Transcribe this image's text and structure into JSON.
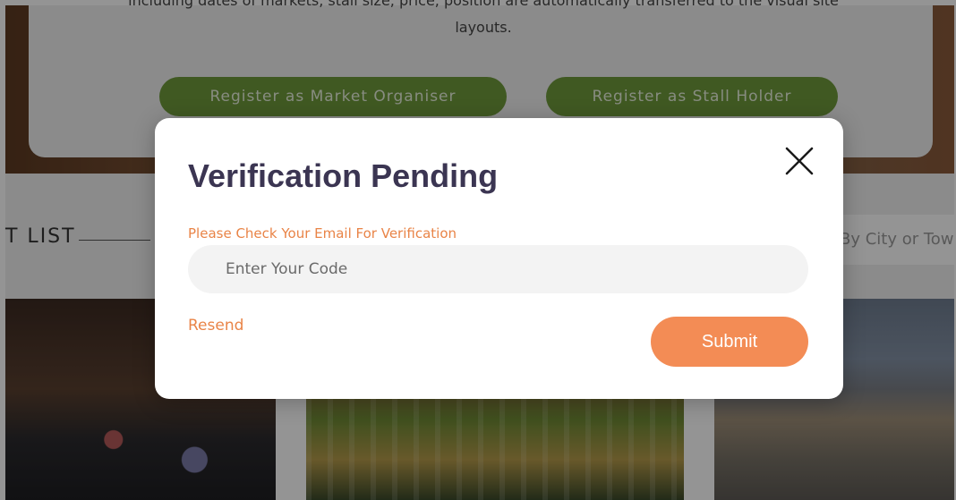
{
  "background": {
    "hero": {
      "text_line1": "including dates of markets, stall size, price, position are automatically transferred to the visual site",
      "text_line2": "layouts.",
      "register_organiser_label": "Register as Market Organiser",
      "register_stall_holder_label": "Register as Stall Holder"
    },
    "list": {
      "title": "T LIST",
      "city_search_placeholder": "By City or Tow"
    }
  },
  "modal": {
    "title": "Verification Pending",
    "subtitle": "Please Check Your Email For Verification",
    "code_input": {
      "value": "",
      "placeholder": "Enter Your Code"
    },
    "resend_label": "Resend",
    "submit_label": "Submit",
    "close_icon": "close-icon"
  },
  "colors": {
    "accent_orange": "#f38c55",
    "link_orange": "#e98447",
    "title_color": "#3b3552",
    "hero_button_green": "#6e9a3c"
  }
}
